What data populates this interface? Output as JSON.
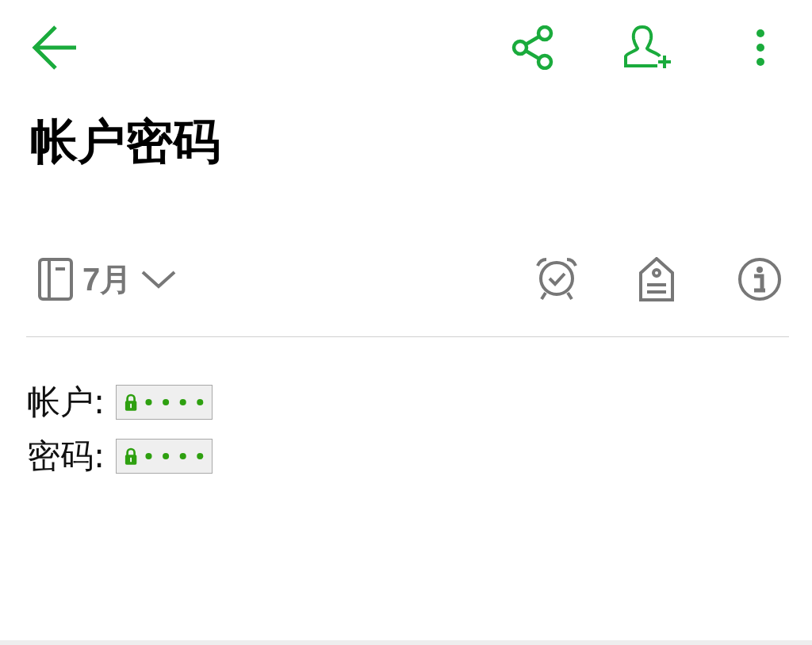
{
  "title": "帐户密码",
  "notebook": {
    "name": "7月"
  },
  "fields": [
    {
      "label": "帐户:",
      "encrypted": true
    },
    {
      "label": "密码:",
      "encrypted": true
    }
  ]
}
